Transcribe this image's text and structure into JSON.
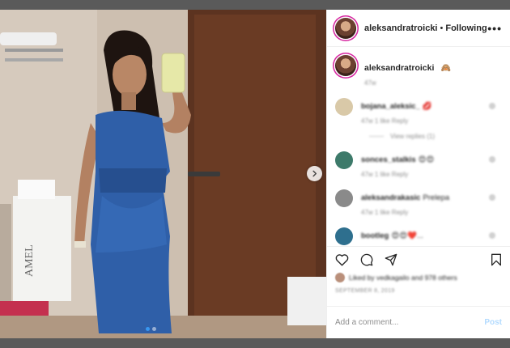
{
  "post": {
    "username": "aleksandratroicki",
    "follow_status": "Following",
    "more_label": "•••",
    "photo_alt": "Woman in blue dress taking a mirror selfie"
  },
  "caption": {
    "username": "aleksandratroicki",
    "emoji": "🙈",
    "time": "47w"
  },
  "comments": [
    {
      "username": "bojana_aleksic_",
      "text": "💋",
      "meta": "47w  1 like  Reply",
      "avatar_color": "#d9c9a8"
    },
    {
      "username": "sonces_stalkis",
      "text": "😍😍",
      "meta": "47w  1 like  Reply",
      "avatar_color": "#3d7a6a"
    },
    {
      "username": "aleksandrakasic",
      "text": "Prelepa",
      "meta": "47w  1 like  Reply",
      "avatar_color": "#8a8a8a"
    },
    {
      "username": "bootleg",
      "text": "😍😍❤️...",
      "meta": "",
      "avatar_color": "#2e6f8e"
    }
  ],
  "view_replies": "View replies (1)",
  "likes": {
    "text": "Liked by vedkagailo and 978 others"
  },
  "date": "SEPTEMBER 8, 2019",
  "add_comment": {
    "placeholder": "Add a comment...",
    "post_label": "Post"
  },
  "icons": {
    "like": "heart-outline-icon",
    "comment": "comment-bubble-icon",
    "share": "paper-plane-icon",
    "save": "bookmark-icon",
    "next": "chevron-right-icon"
  },
  "carousel": {
    "total": 2,
    "active": 1
  },
  "colors": {
    "accent": "#3897f0",
    "story_ring": "#d6249f",
    "post_disabled": "#b3dbff",
    "dress": "#2f5fa8"
  }
}
